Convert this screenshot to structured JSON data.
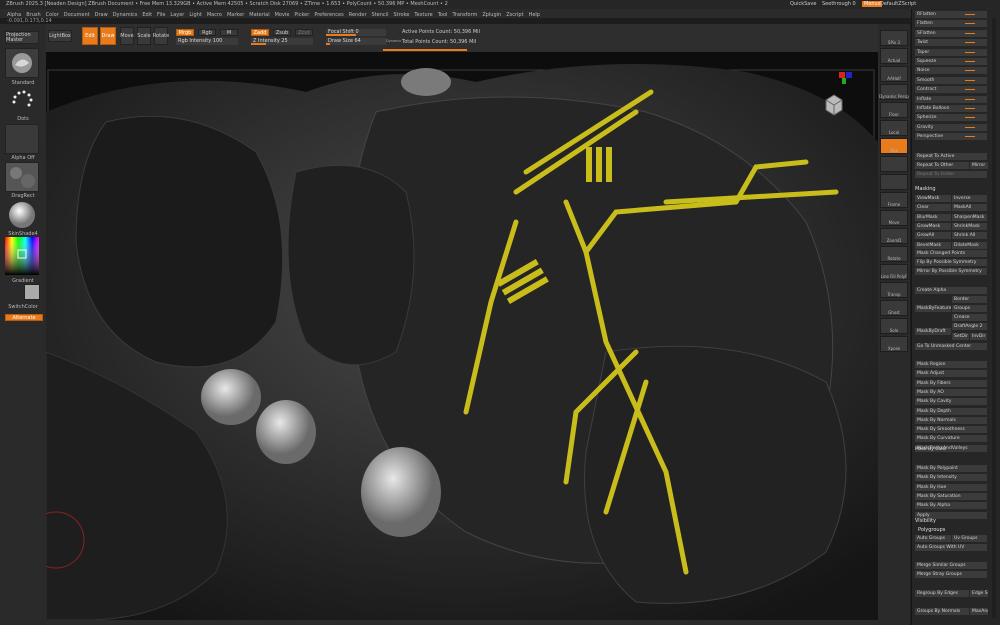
{
  "title_bar": {
    "text": "ZBrush 2025.3 [Neaden Design]    ZBrush Document    • Free Mem 13.329GB • Active Mem 42505 • Scratch Disk 27069 • ZTime • 1.653 • PolyCount • 50.396 MP • MeshCount • 2",
    "quicksave": "QuickSave",
    "see_through": "Seethrough 0",
    "menus": "Menus",
    "default_zscript": "DefaultZScript"
  },
  "menubar": [
    "Alpha",
    "Brush",
    "Color",
    "Document",
    "Draw",
    "Dynamics",
    "Edit",
    "File",
    "Layer",
    "Light",
    "Macro",
    "Marker",
    "Material",
    "Movie",
    "Picker",
    "Preferences",
    "Render",
    "Stencil",
    "Stroke",
    "Texture",
    "Tool",
    "Transform",
    "Zplugin",
    "Zscript",
    "Help"
  ],
  "coords": "-0.091,0.173,0.14",
  "top_toolbar": {
    "projection_master": "Projection Master",
    "lightbox": "LightBox",
    "edit": "Edit",
    "draw": "Draw",
    "move": "Move",
    "scale": "Scale",
    "rotate": "Rotate",
    "mrgb": "Mrgb",
    "rgb": "Rgb",
    "m": "M",
    "rgb_intensity": "Rgb Intensity 100",
    "zadd": "Zadd",
    "zsub": "Zsub",
    "zcut": "Zcut",
    "z_intensity": "Z Intensity 25",
    "focal_shift": "Focal Shift 0",
    "draw_size": "Draw Size 64",
    "dynamic": "Dynamic",
    "active_points": "Active Points Count: 50,396 Mil",
    "total_points": "Total Points Count: 50,396 Mil"
  },
  "left_panel": {
    "brush": "Standard",
    "stroke": "Dots",
    "alpha": "Alpha Off",
    "texture": "DragRect",
    "material": "SkinShade4",
    "gradient": "Gradient",
    "switch_color": "SwitchColor",
    "alternate": "Alternate"
  },
  "shelf": [
    "SPix 3",
    "Actual",
    "AAHalf",
    "Dynamic Persp",
    "Floor",
    "Local",
    "Xyz",
    "",
    "",
    "Frame",
    "Move",
    "ZoomD",
    "Rotate",
    "Line Fill PolyF",
    "Transp",
    "Ghost",
    "Solo",
    "Xpose"
  ],
  "palette": {
    "sliders": [
      "RFlatten",
      "Flatten",
      "SFlatten",
      "Twist",
      "Taper",
      "Squeeze",
      "Noise",
      "Smooth",
      "Contract",
      "Inflate",
      "Inflate Balloon",
      "Spherize",
      "Gravity",
      "Perspective"
    ],
    "repeat_to_active": "Repeat To Active",
    "repeat_to_other": "Repeat To Other",
    "mirror": "Mirror",
    "repeat_to_folder": "Repeat To Folder",
    "masking_header": "Masking",
    "masking_pairs": [
      [
        "ViewMask",
        "Inverse"
      ],
      [
        "Clear",
        "MaskAll"
      ],
      [
        "BlurMask",
        "SharpenMask"
      ],
      [
        "GrowMask",
        "ShrinkMask"
      ],
      [
        "GrowAll",
        "Shrink All"
      ],
      [
        "BevelMask",
        "DilateMask"
      ]
    ],
    "mask_changed": "Mask Changed Points",
    "flip_by_sym": "Flip By Possible Symmetry",
    "mirror_by_sym": "Mirror By Possible Symmetry",
    "create_alpha": "Create Alpha",
    "border": "Border",
    "groups": "Groups",
    "mask_by_feature": "MaskByFeature",
    "crease": "Crease",
    "mask_by_draft": "MaskByDraft",
    "draft_angle": "DraftAngle 2",
    "set_dir": "SetDir",
    "inv_dir": "InvDir",
    "go_to_unmasked": "Go To Unmasked Center",
    "mask_list": [
      "Mask Region",
      "Mask Adjust",
      "Mask By Fibers",
      "Mask By AO",
      "Mask By Cavity",
      "Mask By Depth",
      "Mask By Normals",
      "Mask By Smoothness",
      "Mask By Curvature",
      "Mask PeaksAndValleys"
    ],
    "mask_by_color_header": "Mask By Color",
    "mask_color_list": [
      "Mask By Polypaint",
      "Mask By Intensity",
      "Mask By Hue",
      "Mask By Saturation",
      "Mask By Alpha",
      "Apply"
    ],
    "visibility": "Visibility",
    "polygroups": "Polygroups",
    "auto_groups": "Auto Groups",
    "uv_groups": "Uv Groups",
    "auto_groups_with_uv": "Auto Groups With UV",
    "merge_similar": "Merge Similar Groups",
    "merge_stray": "Merge Stray Groups",
    "regroup_by_edges": "Regroup By Edges",
    "edge_s": "Edge Sc",
    "groups_by_normals": "Groups By Normals",
    "max_ang": "MaxAng"
  }
}
